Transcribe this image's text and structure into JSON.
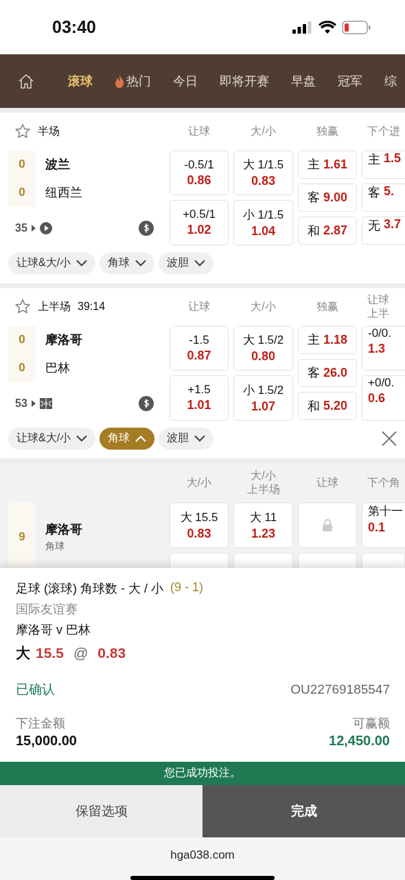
{
  "status_bar": {
    "time": "03:40"
  },
  "nav": {
    "items": [
      {
        "label": "滚球",
        "kind": "text",
        "selected": true
      },
      {
        "label": "热门",
        "kind": "hot",
        "selected": false
      },
      {
        "label": "今日",
        "kind": "text",
        "selected": false
      },
      {
        "label": "即将开赛",
        "kind": "text",
        "selected": false
      },
      {
        "label": "早盘",
        "kind": "text",
        "selected": false
      },
      {
        "label": "冠军",
        "kind": "text",
        "selected": false
      },
      {
        "label": "综",
        "kind": "text",
        "selected": false
      }
    ]
  },
  "matches": [
    {
      "period": "半场",
      "headers": [
        [
          "让球"
        ],
        [
          "大/小"
        ],
        [
          "独赢"
        ],
        [
          "下个进"
        ]
      ],
      "scores": [
        "0",
        "0"
      ],
      "teams": [
        "波兰",
        "纽西兰"
      ],
      "minute": "35",
      "kind": "video",
      "markets": [
        {
          "kind": "two-way",
          "cells": [
            {
              "line": "-0.5/1",
              "odds": "0.86"
            },
            {
              "line": "+0.5/1",
              "odds": "1.02"
            }
          ]
        },
        {
          "kind": "two-way",
          "cells": [
            {
              "line": "大 1/1.5",
              "odds": "0.83"
            },
            {
              "line": "小 1/1.5",
              "odds": "1.04"
            }
          ]
        },
        {
          "kind": "three-way",
          "cells": [
            {
              "line": "主",
              "odds": "1.61"
            },
            {
              "line": "客",
              "odds": "9.00"
            },
            {
              "line": "和",
              "odds": "2.87"
            }
          ]
        },
        {
          "kind": "three-way",
          "cells": [
            {
              "line": "主",
              "odds": "1.5"
            },
            {
              "line": "客",
              "odds": "5."
            },
            {
              "line": "无",
              "odds": "3.7"
            }
          ]
        }
      ],
      "filters": [
        {
          "label": "让球&大/小",
          "expanded": false
        },
        {
          "label": "角球",
          "expanded": false
        },
        {
          "label": "波胆",
          "expanded": false
        }
      ],
      "closable": false
    },
    {
      "period": "上半场",
      "clock": "39:14",
      "headers": [
        [
          "让球"
        ],
        [
          "大/小"
        ],
        [
          "独赢"
        ],
        [
          "让球",
          "上半"
        ]
      ],
      "scores": [
        "0",
        "0"
      ],
      "teams": [
        "摩洛哥",
        "巴林"
      ],
      "minute": "53",
      "kind": "pitch",
      "markets": [
        {
          "kind": "two-way",
          "cells": [
            {
              "line": "-1.5",
              "odds": "0.87"
            },
            {
              "line": "+1.5",
              "odds": "1.01"
            }
          ]
        },
        {
          "kind": "two-way",
          "cells": [
            {
              "line": "大 1.5/2",
              "odds": "0.80"
            },
            {
              "line": "小 1.5/2",
              "odds": "1.07"
            }
          ]
        },
        {
          "kind": "three-way",
          "cells": [
            {
              "line": "主",
              "odds": "1.18"
            },
            {
              "line": "客",
              "odds": "26.0"
            },
            {
              "line": "和",
              "odds": "5.20"
            }
          ]
        },
        {
          "kind": "two-way",
          "cells": [
            {
              "line": "-0/0.",
              "odds": "1.3"
            },
            {
              "line": "+0/0.",
              "odds": "0.6"
            }
          ]
        }
      ],
      "filters": [
        {
          "label": "让球&大/小",
          "expanded": false
        },
        {
          "label": "角球",
          "expanded": true
        },
        {
          "label": "波胆",
          "expanded": false
        }
      ],
      "closable": true
    }
  ],
  "corners": {
    "headers": [
      [
        "大/小"
      ],
      [
        "大/小",
        "上半场"
      ],
      [
        "让球"
      ],
      [
        "下个角"
      ]
    ],
    "score": "9",
    "team": "摩洛哥",
    "subtitle": "角球",
    "cells": [
      {
        "line": "大 15.5",
        "odds": "0.83",
        "locked": false
      },
      {
        "line": "大 11",
        "odds": "1.23",
        "locked": false
      },
      {
        "locked": true
      },
      {
        "line": "第十一",
        "odds": "0.1",
        "locked": false
      }
    ]
  },
  "bet_slip": {
    "market": "足球 (滚球) 角球数 - 大 / 小",
    "score": "(9 - 1)",
    "league": "国际友谊赛",
    "fixture": "摩洛哥 v 巴林",
    "selection": {
      "side": "大",
      "line": "15.5",
      "at": "@",
      "odds": "0.83"
    },
    "status": "已确认",
    "reference": "OU22769185547",
    "stake_label": "下注金额",
    "stake": "15,000.00",
    "win_label": "可赢额",
    "win": "12,450.00",
    "banner": "您已成功投注。",
    "buttons": [
      {
        "label": "保留选项",
        "kind": "secondary"
      },
      {
        "label": "完成",
        "kind": "primary"
      }
    ]
  },
  "browser": {
    "url": "hga038.com"
  }
}
